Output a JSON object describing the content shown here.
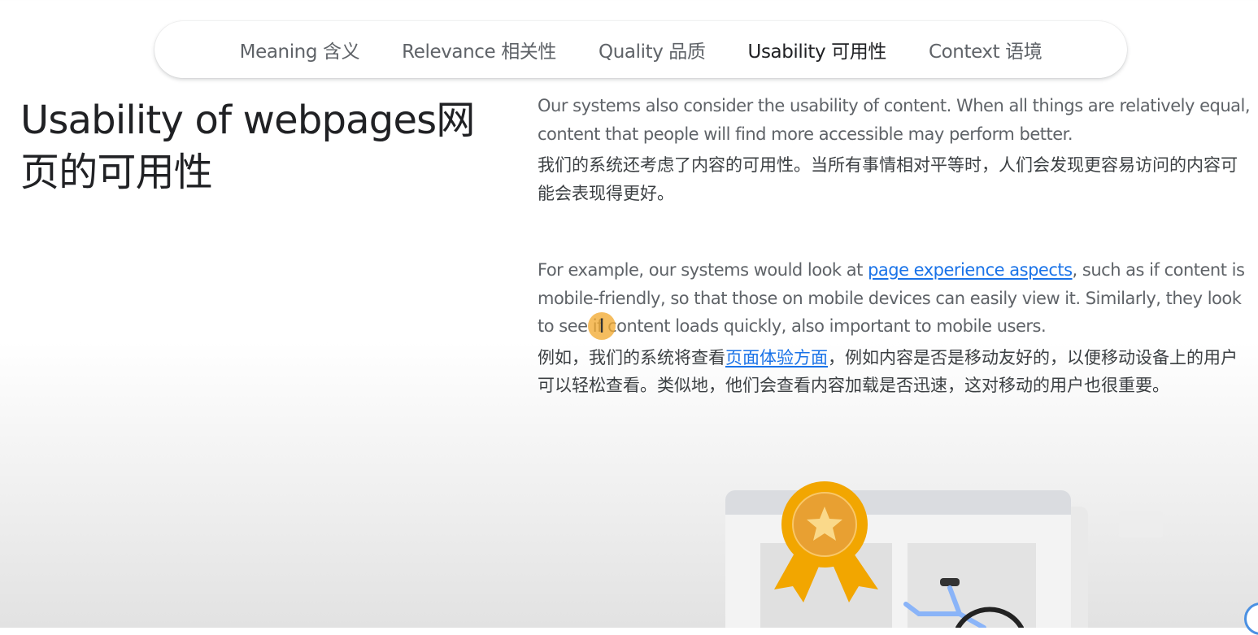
{
  "tabs": [
    {
      "label": "Meaning 含义",
      "active": false
    },
    {
      "label": "Relevance 相关性",
      "active": false
    },
    {
      "label": "Quality 品质",
      "active": false
    },
    {
      "label": "Usability 可用性",
      "active": true
    },
    {
      "label": "Context 语境",
      "active": false
    }
  ],
  "heading": "Usability of webpages网页的可用性",
  "block1": {
    "en": "Our systems also consider the usability of content. When all things are relatively equal, content that people will find more accessible may perform better.",
    "zh": "我们的系统还考虑了内容的可用性。当所有事情相对平等时，人们会发现更容易访问的内容可能会表现得更好。"
  },
  "block2": {
    "en_before": "For example, our systems would look at ",
    "en_link": "page experience aspects",
    "en_after": ", such as if content is mobile-friendly, so that those on mobile devices can easily view it. Similarly, they look to see if content loads quickly, also important to mobile users.",
    "zh_before": "例如，我们的系统将查看",
    "zh_link": "页面体验方面",
    "zh_after": "，例如内容是否是移动友好的，以便移动设备上的用户可以轻松查看。类似地，他们会查看内容加载是否迅速，这对移动的用户也很重要。"
  },
  "cursor": {
    "icon": "text-cursor-icon",
    "highlight_color": "#f2aa32"
  },
  "illustration": {
    "icons": [
      "award-ribbon-icon",
      "star-icon",
      "bicycle-icon"
    ]
  },
  "colors": {
    "link": "#1a73e8",
    "active_tab": "#202124",
    "inactive_tab": "#5f6368"
  }
}
